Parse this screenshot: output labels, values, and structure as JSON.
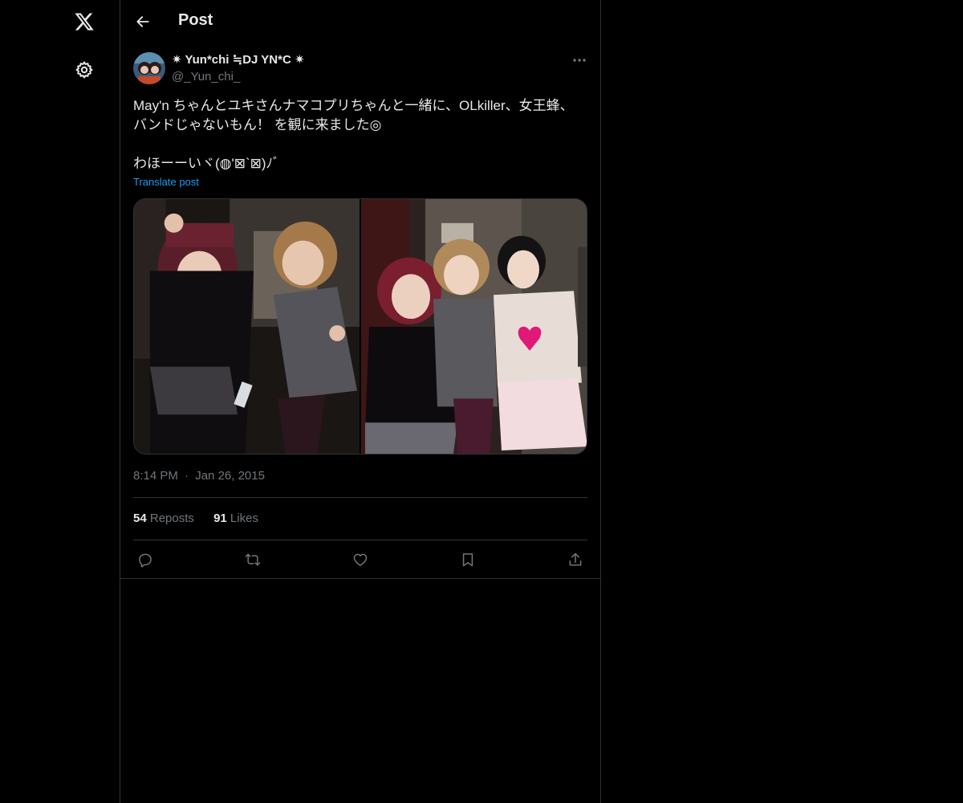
{
  "nav": {
    "logo_icon": "x-logo-icon",
    "settings_icon": "gear-icon"
  },
  "header": {
    "back_icon": "arrow-left-icon",
    "title": "Post"
  },
  "post": {
    "author": {
      "display_name": "✷ Yun*chi ≒DJ YN*C ✷",
      "handle": "@_Yun_chi_"
    },
    "more_icon": "more-horizontal-icon",
    "text_lines": [
      "May'n ちゃんとユキさんナマコプリちゃんと一緒に、OLkiller、女王蜂、",
      "バンドじゃないもん！ を観に来ました◎",
      "",
      "わほーーいヾ(◍'⊠`⊠)ﾉﾞ"
    ],
    "translate_label": "Translate post",
    "time": "8:14 PM",
    "separator": "·",
    "date": "Jan 26, 2015",
    "stats": {
      "reposts_count": "54",
      "reposts_label": "Reposts",
      "likes_count": "91",
      "likes_label": "Likes"
    },
    "actions": [
      "reply-icon",
      "repost-icon",
      "like-icon",
      "bookmark-icon",
      "share-icon"
    ]
  },
  "colors": {
    "background": "#000000",
    "text": "#e7e9ea",
    "secondary": "#71767b",
    "border": "#2f3336",
    "link": "#1d9bf0"
  }
}
